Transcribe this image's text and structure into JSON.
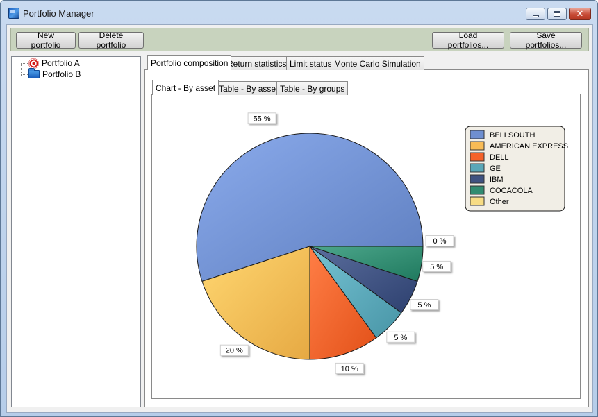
{
  "window": {
    "title": "Portfolio Manager"
  },
  "toolbar": {
    "new_portfolio": "New portfolio",
    "delete_portfolio": "Delete portfolio",
    "load_portfolios": "Load portfolios...",
    "save_portfolios": "Save portfolios..."
  },
  "tree": {
    "items": [
      {
        "label": "Portfolio A",
        "icon": "target-icon"
      },
      {
        "label": "Portfolio B",
        "icon": "folder-icon"
      }
    ]
  },
  "tabs": {
    "main": [
      {
        "label": "Portfolio composition",
        "active": true
      },
      {
        "label": "Return statistics",
        "active": false
      },
      {
        "label": "Limit status",
        "active": false
      },
      {
        "label": "Monte Carlo Simulation",
        "active": false
      }
    ],
    "sub": [
      {
        "label": "Chart - By asset",
        "active": true
      },
      {
        "label": "Table - By asset",
        "active": false
      },
      {
        "label": "Table - By groups",
        "active": false
      }
    ]
  },
  "chart_data": {
    "type": "pie",
    "slices": [
      {
        "name": "BELLSOUTH",
        "value": 55,
        "label": "55 %",
        "color": "#6f8fd0"
      },
      {
        "name": "AMERICAN EXPRESS",
        "value": 20,
        "label": "20 %",
        "color": "#f8bb55"
      },
      {
        "name": "DELL",
        "value": 10,
        "label": "10 %",
        "color": "#f4622a"
      },
      {
        "name": "GE",
        "value": 5,
        "label": "5 %",
        "color": "#5aa7b8"
      },
      {
        "name": "IBM",
        "value": 5,
        "label": "5 %",
        "color": "#3f5281"
      },
      {
        "name": "COCACOLA",
        "value": 5,
        "label": "5 %",
        "color": "#318b70"
      },
      {
        "name": "Other",
        "value": 0,
        "label": "0 %",
        "color": "#f7dc84"
      }
    ],
    "legend_position": "top-right"
  }
}
